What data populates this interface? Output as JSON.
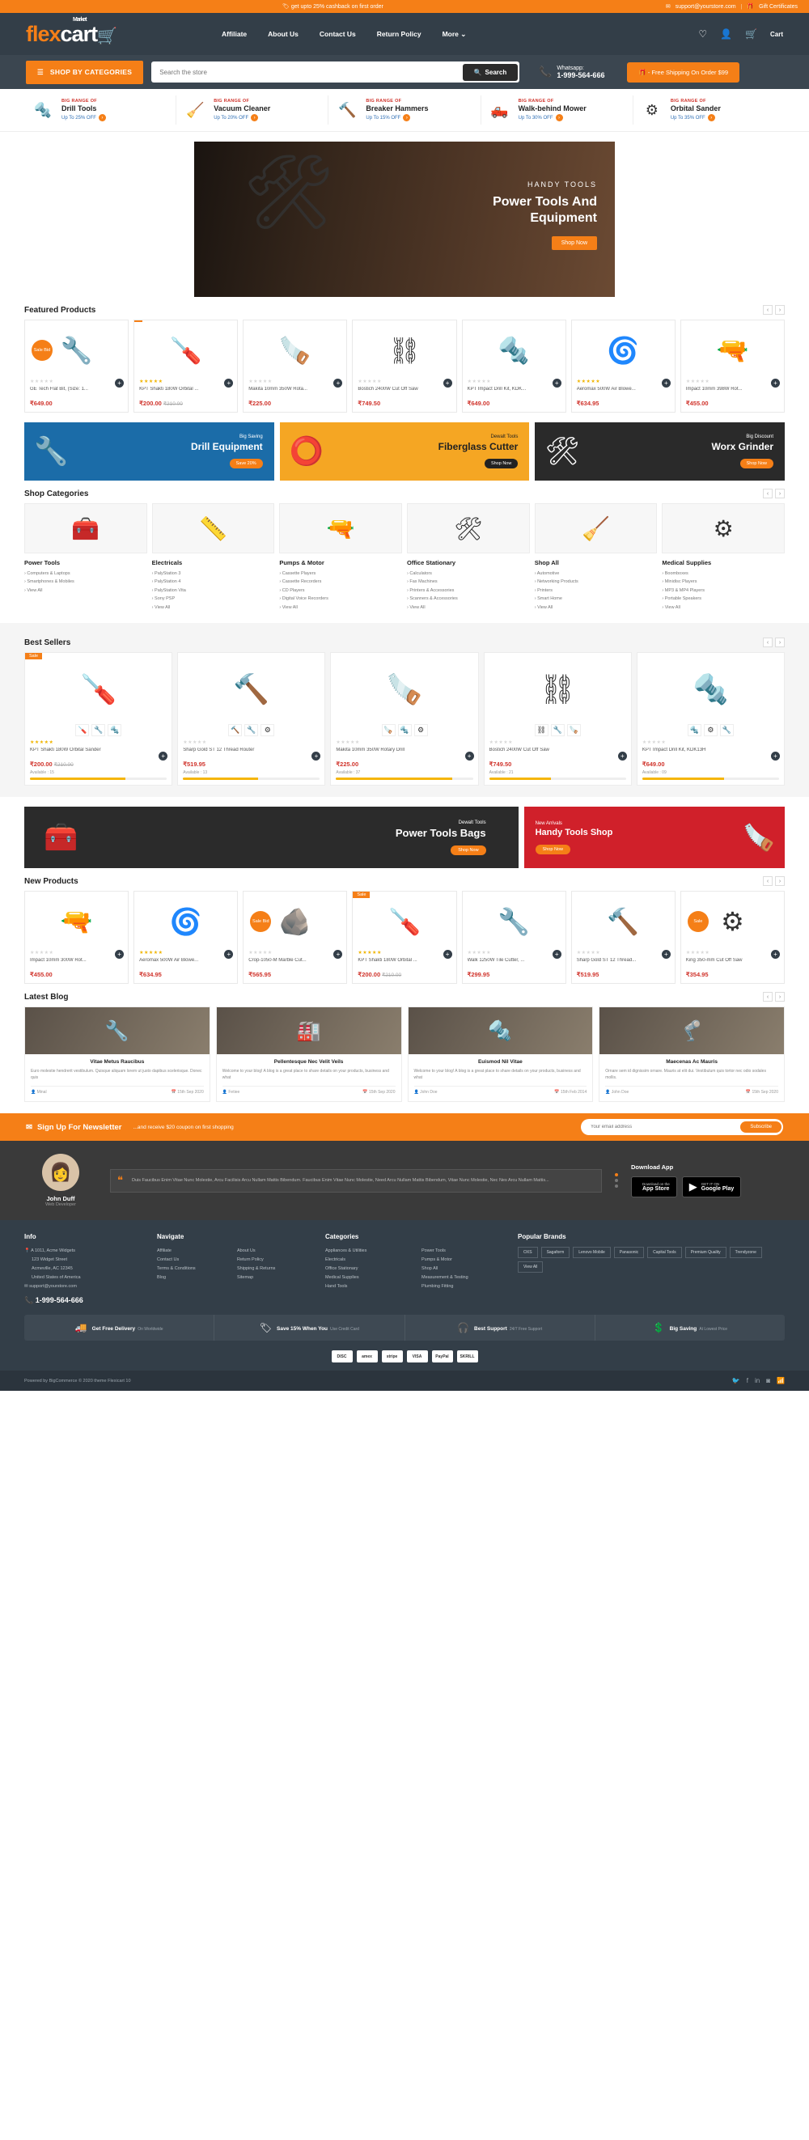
{
  "topbar": {
    "promo": "get upto 25% cashback on first order",
    "email": "support@yourstore.com",
    "gift": "Gift Certificates",
    "tag_icon": "tag-icon",
    "mail_icon": "mail-icon",
    "gift_icon": "gift-icon"
  },
  "header": {
    "logo_flex": "flex",
    "logo_cart": "cart",
    "logo_market": "Market",
    "nav": [
      {
        "label": "Affiliate"
      },
      {
        "label": "About Us"
      },
      {
        "label": "Contact Us"
      },
      {
        "label": "Return Policy"
      },
      {
        "label": "More"
      }
    ],
    "cart_label": "Cart"
  },
  "search": {
    "shop_by_categories": "SHOP BY CATEGORIES",
    "placeholder": "Search the store",
    "button": "Search",
    "whatsapp_label": "Whatsapp:",
    "whatsapp_number": "1-999-564-666",
    "free_shipping": "- Free Shipping On Order $99"
  },
  "category_strip": [
    {
      "kicker": "BIG RANGE OF",
      "title": "Drill Tools",
      "offer": "Up To 25% OFF",
      "icon": "drill-icon"
    },
    {
      "kicker": "BIG RANGE OF",
      "title": "Vacuum Cleaner",
      "offer": "Up To 20% OFF",
      "icon": "vacuum-icon"
    },
    {
      "kicker": "BIG RANGE OF",
      "title": "Breaker Hammers",
      "offer": "Up To 15% OFF",
      "icon": "hammer-icon"
    },
    {
      "kicker": "BIG RANGE OF",
      "title": "Walk-behind Mower",
      "offer": "Up To 30% OFF",
      "icon": "mower-icon"
    },
    {
      "kicker": "BIG RANGE OF",
      "title": "Orbital Sander",
      "offer": "Up To 35% OFF",
      "icon": "sander-icon"
    }
  ],
  "hero": {
    "kicker": "HANDY TOOLS",
    "title": "Power Tools And Equipment",
    "button": "Shop Now"
  },
  "featured": {
    "heading": "Featured Products",
    "products": [
      {
        "name": "GE Tech Flat Bit, (Size: 1...",
        "price": "₹649.00",
        "old": "",
        "badge": "Sale",
        "round": "Sale Bid",
        "icon": "flat-bit-icon"
      },
      {
        "name": "KPT Shakti 180W Orbital ...",
        "price": "₹200.00",
        "old": "₹210.00",
        "badge": "",
        "round": "",
        "icon": "plier-icon"
      },
      {
        "name": "Makita 10mm 350W Rota...",
        "price": "₹225.00",
        "old": "",
        "badge": "",
        "round": "",
        "icon": "saw-icon"
      },
      {
        "name": "Bostich 2400W Cut Off Saw",
        "price": "₹749.50",
        "old": "",
        "badge": "",
        "round": "",
        "icon": "chainsaw-icon"
      },
      {
        "name": "KPT Impact Drill Kit, KDK...",
        "price": "₹649.00",
        "old": "",
        "badge": "",
        "round": "",
        "icon": "jigsaw-icon"
      },
      {
        "name": "Aeromax 500W Air Blowe...",
        "price": "₹634.95",
        "old": "",
        "badge": "",
        "round": "",
        "icon": "blower-icon"
      },
      {
        "name": "Impact 10mm 398W Rot...",
        "price": "₹455.00",
        "old": "",
        "badge": "",
        "round": "",
        "icon": "drill-icon"
      }
    ]
  },
  "promos": [
    {
      "kicker": "Big Saving",
      "title": "Drill Equipment",
      "button": "Save 20%",
      "icon": "impact-wrench-icon"
    },
    {
      "kicker": "Dewalt Tools",
      "title": "Fiberglass Cutter",
      "button": "Shop Now",
      "icon": "cutter-icon"
    },
    {
      "kicker": "Big Discount",
      "title": "Worx Grinder",
      "button": "Shop Now",
      "icon": "grinder-icon"
    }
  ],
  "shop_categories": {
    "heading": "Shop Categories",
    "items": [
      {
        "title": "Power Tools",
        "icon": "toolbag-icon",
        "links": [
          "Computers & Laptops",
          "Smartphones & Mobiles",
          "View All"
        ]
      },
      {
        "title": "Electricals",
        "icon": "tape-icon",
        "links": [
          "PalyStation 3",
          "PalyStation 4",
          "PalyStation Vita",
          "Sony PSP",
          "View All"
        ]
      },
      {
        "title": "Pumps & Motor",
        "icon": "heatgun-icon",
        "links": [
          "Cassette Players",
          "Cassette Recorders",
          "CD Players",
          "Digital Voice Recorders",
          "View All"
        ]
      },
      {
        "title": "Office Stationary",
        "icon": "grinder-icon",
        "links": [
          "Calculators",
          "Fax Machines",
          "Printers & Accessories",
          "Scanners & Accessories",
          "View All"
        ]
      },
      {
        "title": "Shop All",
        "icon": "vacuum-icon",
        "links": [
          "Automotive",
          "Networking Products",
          "Printers",
          "Smart Home",
          "View All"
        ]
      },
      {
        "title": "Medical Supplies",
        "icon": "sander-icon",
        "links": [
          "Boomboxes",
          "Minidisc Players",
          "MP3 & MP4 Players",
          "Portable Speakers",
          "View All"
        ]
      }
    ]
  },
  "best_sellers": {
    "heading": "Best Sellers",
    "products": [
      {
        "name": "KPT Shakti 180W Orbital Sander",
        "price": "₹200.00",
        "old": "₹210.00",
        "badge": "Sale",
        "avail": "Available : 15",
        "pct": 70,
        "icon": "plier-icon"
      },
      {
        "name": "Sharp Gold ST 12 Thread Router",
        "price": "₹519.95",
        "old": "",
        "badge": "",
        "avail": "Available : 13",
        "pct": 55,
        "icon": "router-icon"
      },
      {
        "name": "Makita 10mm 350W Rotary Drill",
        "price": "₹225.00",
        "old": "",
        "badge": "",
        "avail": "Available : 37",
        "pct": 85,
        "icon": "saw-icon"
      },
      {
        "name": "Bostich 2400W Cut Off Saw",
        "price": "₹749.50",
        "old": "",
        "badge": "",
        "avail": "Available : 21",
        "pct": 45,
        "icon": "chainsaw-icon"
      },
      {
        "name": "KPT Impact Drill Kit, KDK13H",
        "price": "₹649.00",
        "old": "",
        "badge": "",
        "avail": "Available : 09",
        "pct": 60,
        "icon": "jigsaw-icon"
      }
    ]
  },
  "mid_banners": [
    {
      "kicker": "Dewalt Tools",
      "title": "Power Tools Bags",
      "button": "Shop Now",
      "icon": "toolbag-icon"
    },
    {
      "kicker": "New Arrivals",
      "title": "Handy Tools Shop",
      "button": "Shop Now",
      "icon": "circular-saw-icon"
    }
  ],
  "new_products": {
    "heading": "New Products",
    "products": [
      {
        "name": "Impact 10mm 300W Rot...",
        "price": "₹455.00",
        "old": "",
        "badge": "",
        "round": "",
        "icon": "drill-icon"
      },
      {
        "name": "Aeromax 500W Air Blowe...",
        "price": "₹634.95",
        "old": "",
        "badge": "",
        "round": "",
        "icon": "blower-icon"
      },
      {
        "name": "Crop-1050-M Marble Cut...",
        "price": "₹565.95",
        "old": "",
        "badge": "",
        "round": "Sale Bid",
        "icon": "marble-cutter-icon"
      },
      {
        "name": "KPT Shakti 180W Orbital ...",
        "price": "₹200.00",
        "old": "₹210.00",
        "badge": "Sale",
        "round": "",
        "icon": "plier-icon"
      },
      {
        "name": "Walk 1250W Tile Cutter, ...",
        "price": "₹299.95",
        "old": "",
        "badge": "",
        "round": "",
        "icon": "tile-cutter-icon"
      },
      {
        "name": "Sharp Gold ST 12 Thread...",
        "price": "₹519.95",
        "old": "",
        "badge": "",
        "round": "",
        "icon": "router-icon"
      },
      {
        "name": "King 350-mm Cut Off Saw",
        "price": "₹354.95",
        "old": "",
        "badge": "",
        "round": "Sale",
        "icon": "cutoff-saw-icon"
      }
    ]
  },
  "blog": {
    "heading": "Latest Blog",
    "posts": [
      {
        "title": "Vitae Metus Raucibus",
        "text": "Euro molestie hendrerit vestibulum. Quisque aliquam lorem ut justo dapibus scelerisque. Donec quis",
        "author": "Minal",
        "date": "15th Sep 2020",
        "icon": "workshop-icon"
      },
      {
        "title": "Pellentesque Nec Velit Veils",
        "text": "Welcome to your blog! A blog is a great place to share details on your products, business and what",
        "author": "Fetiee",
        "date": "15th Sep 2020",
        "icon": "warehouse-icon"
      },
      {
        "title": "Euismod Nil Vitae",
        "text": "Welcome to your blog! A blog is a great place to share details on your products, business and what",
        "author": "John Doe",
        "date": "15th Feb 2014",
        "icon": "bluetool-icon"
      },
      {
        "title": "Maecenas Ac Mauris",
        "text": "Ornare sem id dignissim ornare. Mauris at elit dui. Vestibulum quis tortor nec odio sodales mollis.",
        "author": "John Doe",
        "date": "15th Sep 2020",
        "icon": "legs-icon"
      }
    ]
  },
  "newsletter": {
    "title": "Sign Up For Newsletter",
    "sub": "...and receive $20 coupon on first shopping",
    "placeholder": "Your email address",
    "button": "Subscribe",
    "icon": "envelope-icon"
  },
  "testimonial": {
    "name": "John Duff",
    "role": "Web Developer",
    "text": "Duis Faucibus Enim Vitae Nunc Molestie, Arcu Facilisis Arcu Nullam Mattis Bibendum. Faucibus Enim Vitae Nunc Molestie, Need Arcu Nullam Mattis Bibendum, Vitae Nunc Molestie, Nec Nes Arcu Nullam Mattis...",
    "avatar": "avatar-icon"
  },
  "download_app": {
    "heading": "Download App",
    "badges": [
      {
        "small": "Download on the",
        "big": "App Store",
        "icon": "apple-icon"
      },
      {
        "small": "GET IT ON",
        "big": "Google Play",
        "icon": "play-icon"
      }
    ]
  },
  "footer": {
    "info": {
      "heading": "Info",
      "address_line1": "A 1011, Acme Widgets",
      "address_line2": "123 Widget Street",
      "address_line3": "Acmeville, AC 12345",
      "address_line4": "United States of America",
      "email": "support@yourstore.com",
      "phone": "1-999-564-666",
      "pin_icon": "location-icon",
      "mail_icon": "mail-icon",
      "phone_icon": "phone-icon"
    },
    "navigate": {
      "heading": "Navigate",
      "links": [
        "Affiliate",
        "Contact Us",
        "Terms & Conditions",
        "Blog"
      ]
    },
    "navigate2": {
      "links": [
        "About Us",
        "Return Policy",
        "Shipping & Returns",
        "Sitemap"
      ]
    },
    "categories": {
      "heading": "Categories",
      "col1": [
        "Appliances & Utilities",
        "Electricals",
        "Office Stationary",
        "Medical Supplies",
        "Hand Tools"
      ],
      "col2": [
        "Power Tools",
        "Pumps & Motor",
        "Shop All",
        "Measurement & Testing",
        "Plumbing Fitting"
      ]
    },
    "brands": {
      "heading": "Popular Brands",
      "chips": [
        "OXS",
        "Sagaform",
        "Lenovo Mobile",
        "Panasonic",
        "Capital Tools",
        "Premium Quality",
        "Trendyzone",
        "View All"
      ]
    },
    "services": [
      {
        "s1": "Get Free Delivery",
        "s2": "On Worldwide",
        "icon": "truck-icon"
      },
      {
        "s1": "Save 15% When You",
        "s2": "Use Credit Card",
        "icon": "card-icon"
      },
      {
        "s1": "Best Support",
        "s2": "24/7 Free Support",
        "icon": "support-icon"
      },
      {
        "s1": "Big Saving",
        "s2": "At Lowest Price",
        "icon": "tag-icon"
      }
    ],
    "payments": [
      "DISC",
      "amex",
      "stripe",
      "VISA",
      "PayPal",
      "SKRILL"
    ],
    "copyright": "Powered by BigCommerce © 2020 theme Flexicart 10",
    "socials": [
      "twitter-icon",
      "facebook-icon",
      "linkedin-icon",
      "instagram-icon",
      "rss-icon"
    ]
  }
}
